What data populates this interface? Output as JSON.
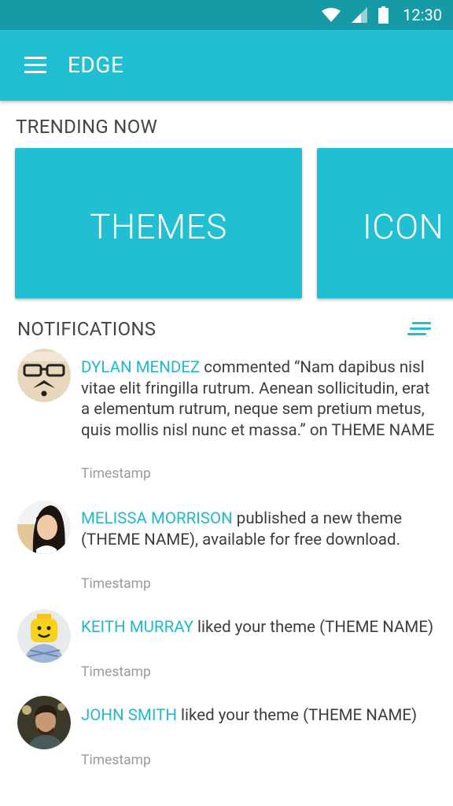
{
  "status_bar": {
    "time": "12:30",
    "icons": [
      "wifi-icon",
      "cell-signal-icon",
      "battery-icon"
    ]
  },
  "app_bar": {
    "title": "EDGE",
    "menu_icon": "hamburger-menu-icon"
  },
  "trending": {
    "heading": "TRENDING NOW",
    "tiles": [
      {
        "label": "THEMES"
      },
      {
        "label": "ICON"
      }
    ]
  },
  "notifications": {
    "heading": "NOTIFICATIONS",
    "sort_icon": "sort-icon",
    "items": [
      {
        "user": "DYLAN MENDEZ",
        "text": " commented “Nam dapibus nisl vitae elit fringilla rutrum. Aenean sollicitudin, erat a elementum rutrum, neque sem pretium metus, quis mollis nisl nunc et massa.” on THEME NAME",
        "timestamp": "Timestamp"
      },
      {
        "user": "MELISSA MORRISON",
        "text": " published a new theme (THEME NAME), available for free download.",
        "timestamp": "Timestamp"
      },
      {
        "user": "KEITH MURRAY",
        "text": " liked your theme (THEME NAME)",
        "timestamp": "Timestamp"
      },
      {
        "user": "JOHN SMITH",
        "text": " liked your theme (THEME NAME)",
        "timestamp": "Timestamp"
      }
    ]
  },
  "colors": {
    "accent": "#22bfd2",
    "status_bar": "#169aa6",
    "user_link": "#22b8cc",
    "body_text": "#3d3d3d",
    "timestamp": "#9a9a9a"
  }
}
